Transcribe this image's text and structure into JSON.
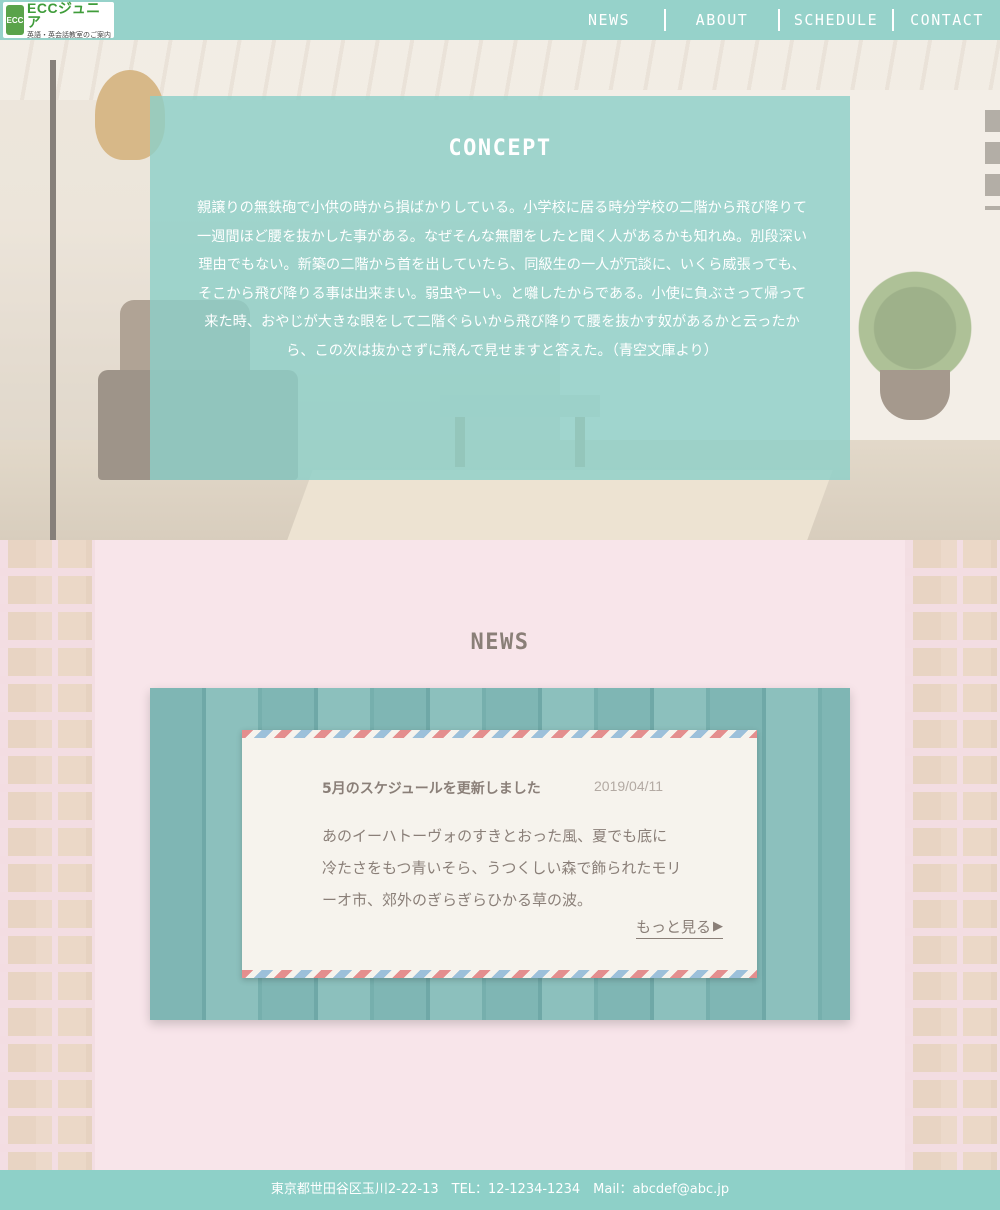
{
  "header": {
    "logo": {
      "title": "ECCジュニア",
      "subtitle": "英語・英会話教室のご案内",
      "mark": "ECC"
    },
    "nav": [
      {
        "label": "NEWS"
      },
      {
        "label": "ABOUT"
      },
      {
        "label": "SCHEDULE"
      },
      {
        "label": "CONTACT"
      }
    ]
  },
  "concept": {
    "title": "CONCEPT",
    "body": "親譲りの無鉄砲で小供の時から損ばかりしている。小学校に居る時分学校の二階から飛び降りて一週間ほど腰を抜かした事がある。なぜそんな無闇をしたと聞く人があるかも知れぬ。別段深い理由でもない。新築の二階から首を出していたら、同級生の一人が冗談に、いくら威張っても、そこから飛び降りる事は出来まい。弱虫やーい。と囃したからである。小使に負ぶさって帰って来た時、おやじが大きな眼をして二階ぐらいから飛び降りて腰を抜かす奴があるかと云ったから、この次は抜かさずに飛んで見せますと答えた。（青空文庫より）"
  },
  "news": {
    "heading": "NEWS",
    "item": {
      "title": "5月のスケジュールを更新しました",
      "date": "2019/04/11",
      "body": "あのイーハトーヴォのすきとおった風、夏でも底に冷たさをもつ青いそら、うつくしい森で飾られたモリーオ市、郊外のぎらぎらひかる草の波。",
      "more_label": "もっと見る",
      "more_arrow": "▶"
    }
  },
  "footer": {
    "text": "東京都世田谷区玉川2-22-13　TEL：12-1234-1234　Mail：abcdef@abc.jp"
  },
  "colors": {
    "accent": "#8ed0c8",
    "news_bg": "#f8e5ea",
    "text_muted": "#8a7f78"
  }
}
